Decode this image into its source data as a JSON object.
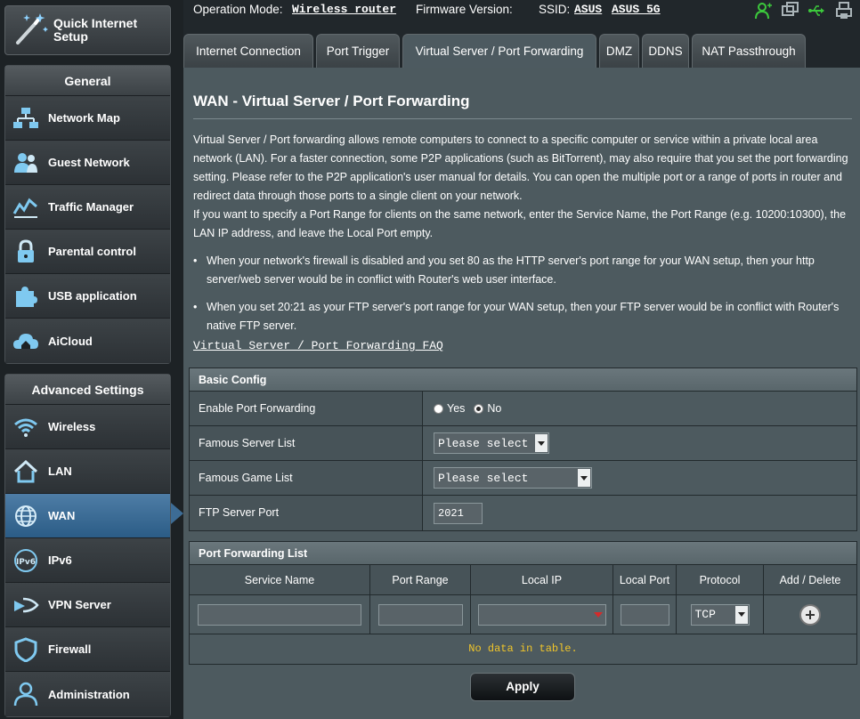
{
  "sidebar": {
    "qis_label": "Quick Internet Setup",
    "general_title": "General",
    "general_items": [
      {
        "label": "Network Map"
      },
      {
        "label": "Guest Network"
      },
      {
        "label": "Traffic Manager"
      },
      {
        "label": "Parental control"
      },
      {
        "label": "USB application"
      },
      {
        "label": "AiCloud"
      }
    ],
    "advanced_title": "Advanced Settings",
    "advanced_items": [
      {
        "label": "Wireless"
      },
      {
        "label": "LAN"
      },
      {
        "label": "WAN"
      },
      {
        "label": "IPv6"
      },
      {
        "label": "VPN Server"
      },
      {
        "label": "Firewall"
      },
      {
        "label": "Administration"
      }
    ],
    "active_item": "WAN"
  },
  "topbar": {
    "op_mode_label": "Operation Mode:",
    "op_mode_value": "Wireless router",
    "firmware_label": "Firmware Version:",
    "ssid_label": "SSID:",
    "ssid_1": "ASUS",
    "ssid_2": "ASUS_5G"
  },
  "tabs": [
    {
      "label": "Internet Connection"
    },
    {
      "label": "Port Trigger"
    },
    {
      "label": "Virtual Server / Port Forwarding"
    },
    {
      "label": "DMZ"
    },
    {
      "label": "DDNS"
    },
    {
      "label": "NAT Passthrough"
    }
  ],
  "active_tab": "Virtual Server / Port Forwarding",
  "page": {
    "title": "WAN - Virtual Server / Port Forwarding",
    "description": "Virtual Server / Port forwarding allows remote computers to connect to a specific computer or service within a private local area network (LAN). For a faster connection, some P2P applications (such as BitTorrent), may also require that you set the port forwarding setting. Please refer to the P2P application's user manual for details. You can open the multiple port or a range of ports in router and redirect data through those ports to a single client on your network.",
    "description2": "If you want to specify a Port Range for clients on the same network, enter the Service Name, the Port Range (e.g. 10200:10300), the LAN IP address, and leave the Local Port empty.",
    "bullet1": "When your network's firewall is disabled and you set 80 as the HTTP server's port range for your WAN setup, then your http server/web server would be in conflict with Router's web user interface.",
    "bullet2": "When you set 20:21 as your FTP server's port range for your WAN setup, then your FTP server would be in conflict with Router's native FTP server.",
    "faq_link": "Virtual Server / Port Forwarding FAQ"
  },
  "basic_config": {
    "header": "Basic Config",
    "enable_label": "Enable Port Forwarding",
    "yes_label": "Yes",
    "no_label": "No",
    "enabled": false,
    "server_list_label": "Famous Server List",
    "server_list_value": "Please select",
    "game_list_label": "Famous Game List",
    "game_list_value": "Please select",
    "ftp_port_label": "FTP Server Port",
    "ftp_port_value": "2021"
  },
  "port_forwarding": {
    "header": "Port Forwarding List",
    "columns": [
      "Service Name",
      "Port Range",
      "Local IP",
      "Local Port",
      "Protocol",
      "Add / Delete"
    ],
    "protocol_value": "TCP",
    "empty_message": "No data in table."
  },
  "apply_label": "Apply",
  "colors": {
    "panel_bg": "#4d5a5f",
    "active_menu": "#3d6c95",
    "empty_text": "#f0c52a",
    "status_green": "#3cc93c"
  }
}
